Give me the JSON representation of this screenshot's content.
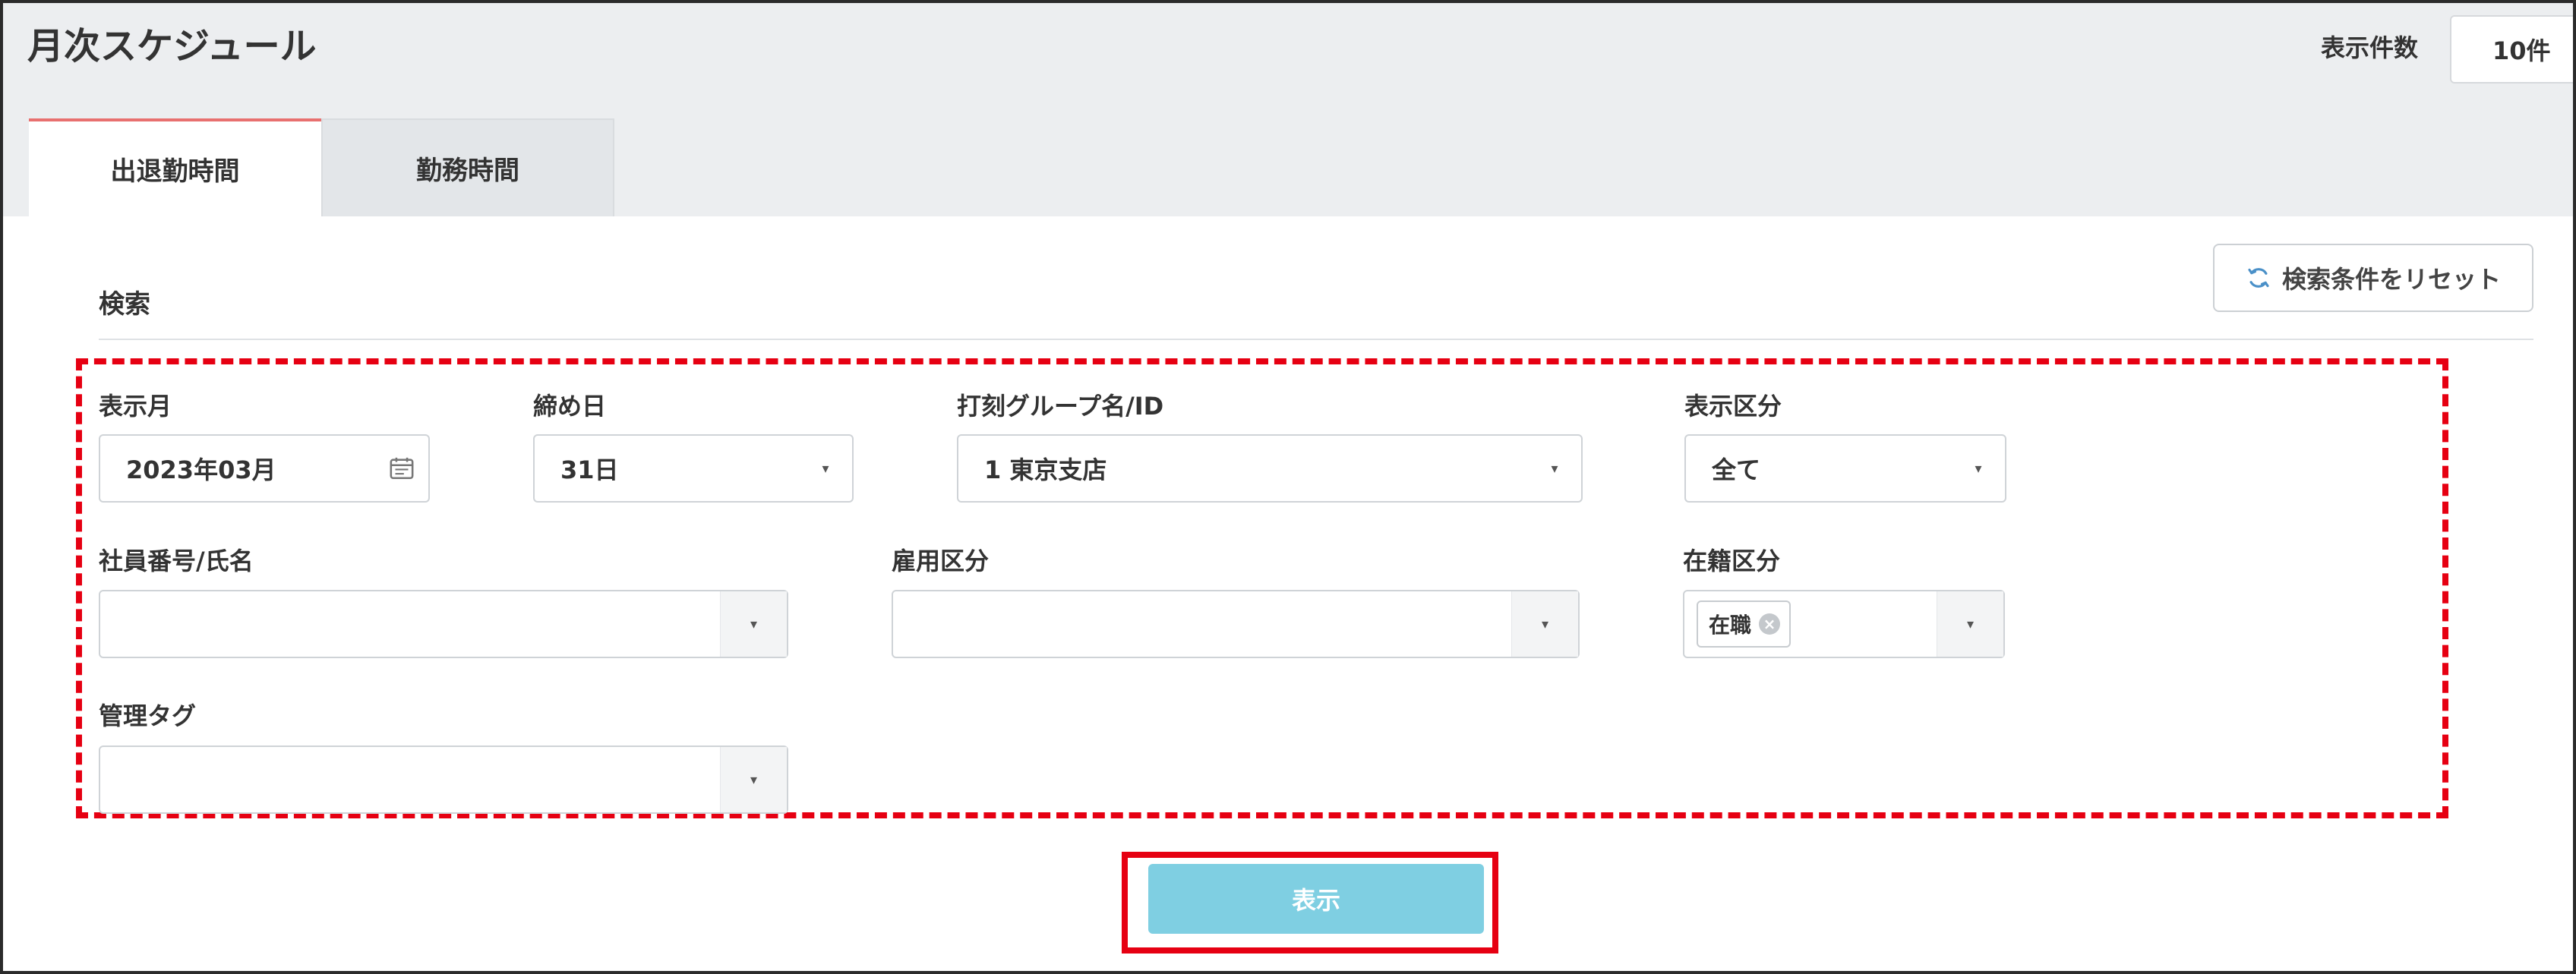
{
  "page": {
    "title": "月次スケジュール",
    "display_count_label": "表示件数",
    "display_count_value": "10件"
  },
  "tabs": [
    {
      "label": "出退勤時間",
      "active": true
    },
    {
      "label": "勤務時間",
      "active": false
    }
  ],
  "search": {
    "title": "検索",
    "reset_label": "検索条件をリセット",
    "fields": {
      "display_month": {
        "label": "表示月",
        "value": "2023年03月"
      },
      "closing_day": {
        "label": "締め日",
        "value": "31日"
      },
      "clock_group": {
        "label": "打刻グループ名/ID",
        "value": "1 東京支店"
      },
      "display_category": {
        "label": "表示区分",
        "value": "全て"
      },
      "employee": {
        "label": "社員番号/氏名",
        "value": ""
      },
      "employment_type": {
        "label": "雇用区分",
        "value": ""
      },
      "enrollment_status": {
        "label": "在籍区分",
        "selected_tag": "在職"
      },
      "management_tag": {
        "label": "管理タグ",
        "value": ""
      }
    },
    "submit_label": "表示"
  },
  "colors": {
    "accent_tab": "#e8706f",
    "highlight": "#e60012",
    "submit_button": "#7fcfe2",
    "header_bg": "#eceef0"
  },
  "icons": [
    "calendar-icon",
    "refresh-icon",
    "chevron-down-icon",
    "close-icon"
  ]
}
